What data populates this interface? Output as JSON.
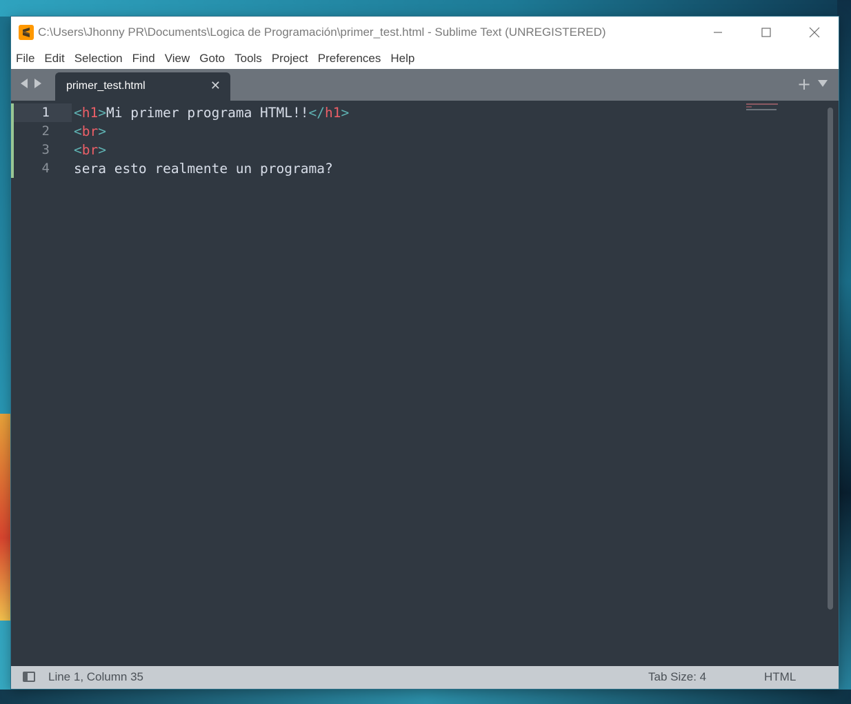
{
  "window": {
    "title": "C:\\Users\\Jhonny PR\\Documents\\Logica de Programación\\primer_test.html - Sublime Text (UNREGISTERED)"
  },
  "menu": [
    "File",
    "Edit",
    "Selection",
    "Find",
    "View",
    "Goto",
    "Tools",
    "Project",
    "Preferences",
    "Help"
  ],
  "tabs": [
    {
      "label": "primer_test.html",
      "active": true
    }
  ],
  "editor": {
    "line_numbers": [
      "1",
      "2",
      "3",
      "4"
    ],
    "active_line": 1,
    "lines": [
      [
        {
          "t": "<",
          "c": "punc"
        },
        {
          "t": "h1",
          "c": "tag"
        },
        {
          "t": ">",
          "c": "punc"
        },
        {
          "t": "Mi primer programa HTML!!",
          "c": "text"
        },
        {
          "t": "</",
          "c": "punc"
        },
        {
          "t": "h1",
          "c": "tag"
        },
        {
          "t": ">",
          "c": "punc"
        }
      ],
      [
        {
          "t": "<",
          "c": "punc"
        },
        {
          "t": "br",
          "c": "tag"
        },
        {
          "t": ">",
          "c": "punc"
        }
      ],
      [
        {
          "t": "<",
          "c": "punc"
        },
        {
          "t": "br",
          "c": "tag"
        },
        {
          "t": ">",
          "c": "punc"
        }
      ],
      [
        {
          "t": "sera esto realmente un programa?",
          "c": "text"
        }
      ]
    ]
  },
  "status": {
    "position": "Line 1, Column 35",
    "tab_size": "Tab Size: 4",
    "syntax": "HTML"
  },
  "colors": {
    "editor_bg": "#303841",
    "tag": "#ec5f67",
    "punctuation": "#5fb3b3",
    "text": "#d8dee9",
    "modified_marker": "#99c794",
    "app_icon": "#ff9800"
  }
}
